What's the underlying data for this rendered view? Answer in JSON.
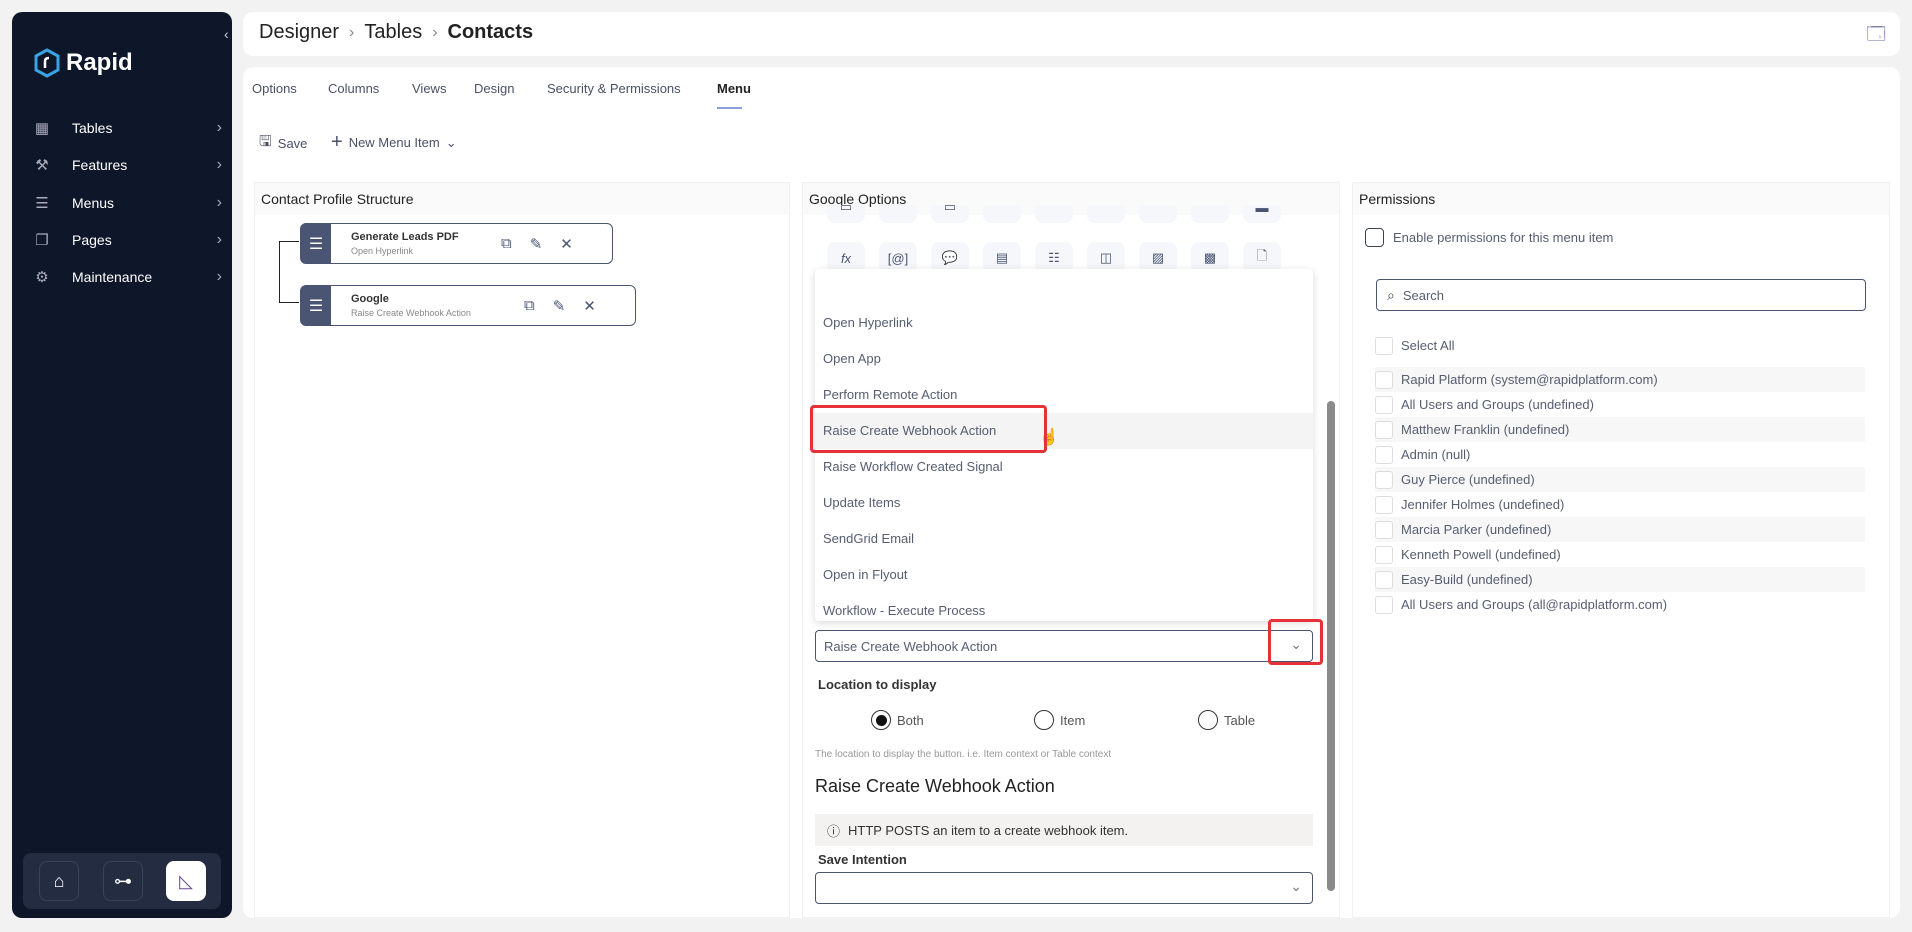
{
  "sidebar": {
    "brand": "Rapid",
    "items": [
      {
        "label": "Tables",
        "icon": "table-icon"
      },
      {
        "label": "Features",
        "icon": "features-icon"
      },
      {
        "label": "Menus",
        "icon": "menu-icon"
      },
      {
        "label": "Pages",
        "icon": "pages-icon"
      },
      {
        "label": "Maintenance",
        "icon": "tools-icon"
      }
    ],
    "bottom": [
      "home-icon",
      "flow-icon",
      "designer-icon"
    ]
  },
  "header": {
    "breadcrumb": [
      "Designer",
      "Tables",
      "Contacts"
    ]
  },
  "tabs": [
    "Options",
    "Columns",
    "Views",
    "Design",
    "Security & Permissions",
    "Menu"
  ],
  "active_tab": "Menu",
  "toolbar": {
    "save": "Save",
    "new_item": "New Menu Item"
  },
  "structure": {
    "title": "Contact Profile Structure",
    "nodes": [
      {
        "title": "Generate Leads PDF",
        "subtitle": "Open Hyperlink"
      },
      {
        "title": "Google",
        "subtitle": "Raise Create Webhook Action"
      }
    ]
  },
  "options": {
    "title": "Google Options",
    "dropdown_options": [
      "Open Hyperlink",
      "Open App",
      "Perform Remote Action",
      "Raise Create Webhook Action",
      "Raise Workflow Created Signal",
      "Update Items",
      "SendGrid Email",
      "Open in Flyout",
      "Workflow - Execute Process"
    ],
    "highlighted": "Raise Create Webhook Action",
    "action_value": "Raise Create Webhook Action",
    "location_label": "Location to display",
    "location_options": [
      "Both",
      "Item",
      "Table"
    ],
    "location_selected": "Both",
    "location_help": "The location to display the button. i.e. Item context or Table context",
    "section_title": "Raise Create Webhook Action",
    "info": "HTTP POSTS an item to a create webhook item.",
    "save_intention_label": "Save Intention",
    "save_intention_value": ""
  },
  "permissions": {
    "title": "Permissions",
    "enable_label": "Enable permissions for this menu item",
    "search_placeholder": "Search",
    "select_all": "Select All",
    "users": [
      "Rapid Platform (system@rapidplatform.com)",
      "All Users and Groups (undefined)",
      "Matthew Franklin (undefined)",
      "Admin (null)",
      "Guy Pierce (undefined)",
      "Jennifer Holmes (undefined)",
      "Marcia Parker (undefined)",
      "Kenneth Powell (undefined)",
      "Easy-Build (undefined)",
      "All Users and Groups (all@rapidplatform.com)"
    ]
  },
  "colors": {
    "sidebar": "#0e1629",
    "accent": "#4a5573",
    "highlight_box": "#e53238"
  }
}
